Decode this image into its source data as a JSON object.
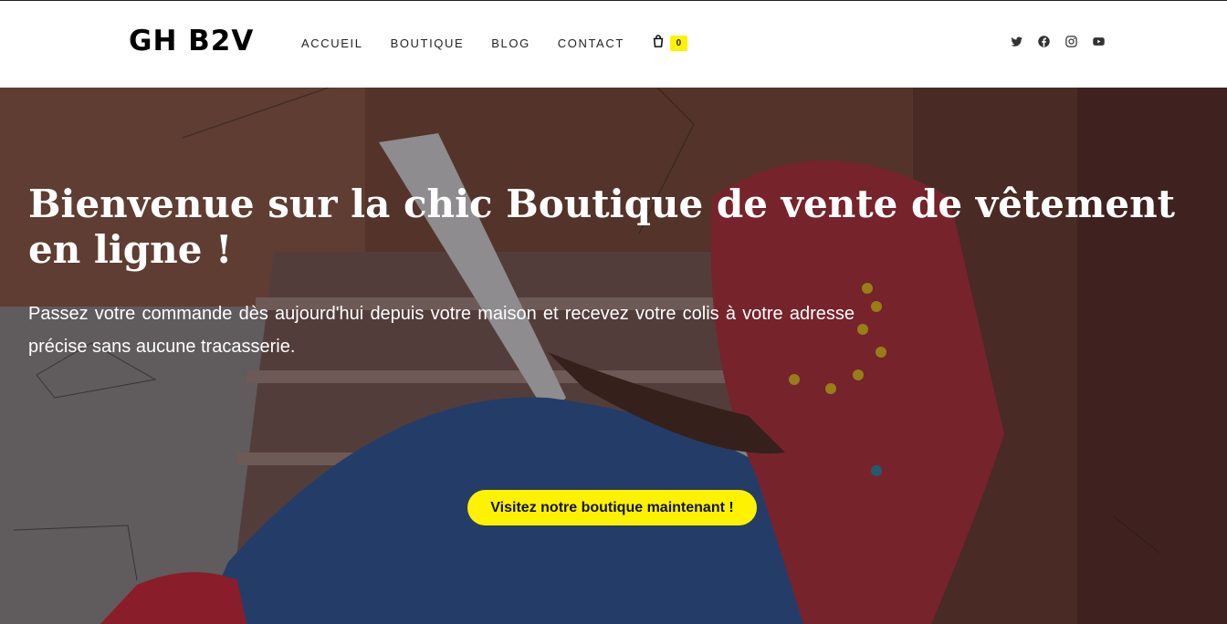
{
  "header": {
    "logo": "GH B2V",
    "nav": [
      {
        "label": "ACCUEIL"
      },
      {
        "label": "BOUTIQUE"
      },
      {
        "label": "BLOG"
      },
      {
        "label": "CONTACT"
      }
    ],
    "cart_count": "0",
    "social_icons": [
      "twitter-icon",
      "facebook-icon",
      "instagram-icon",
      "youtube-icon"
    ]
  },
  "hero": {
    "title": "Bienvenue sur la chic Boutique de vente de vêtement en ligne !",
    "text": "Passez votre commande dès aujourd'hui depuis votre maison et recevez votre colis à votre adresse précise sans aucune tracasserie.",
    "cta_label": "Visitez notre boutique maintenant !"
  },
  "colors": {
    "accent": "#fff200",
    "text_dark": "#222222",
    "hero_text": "#ffffff"
  }
}
